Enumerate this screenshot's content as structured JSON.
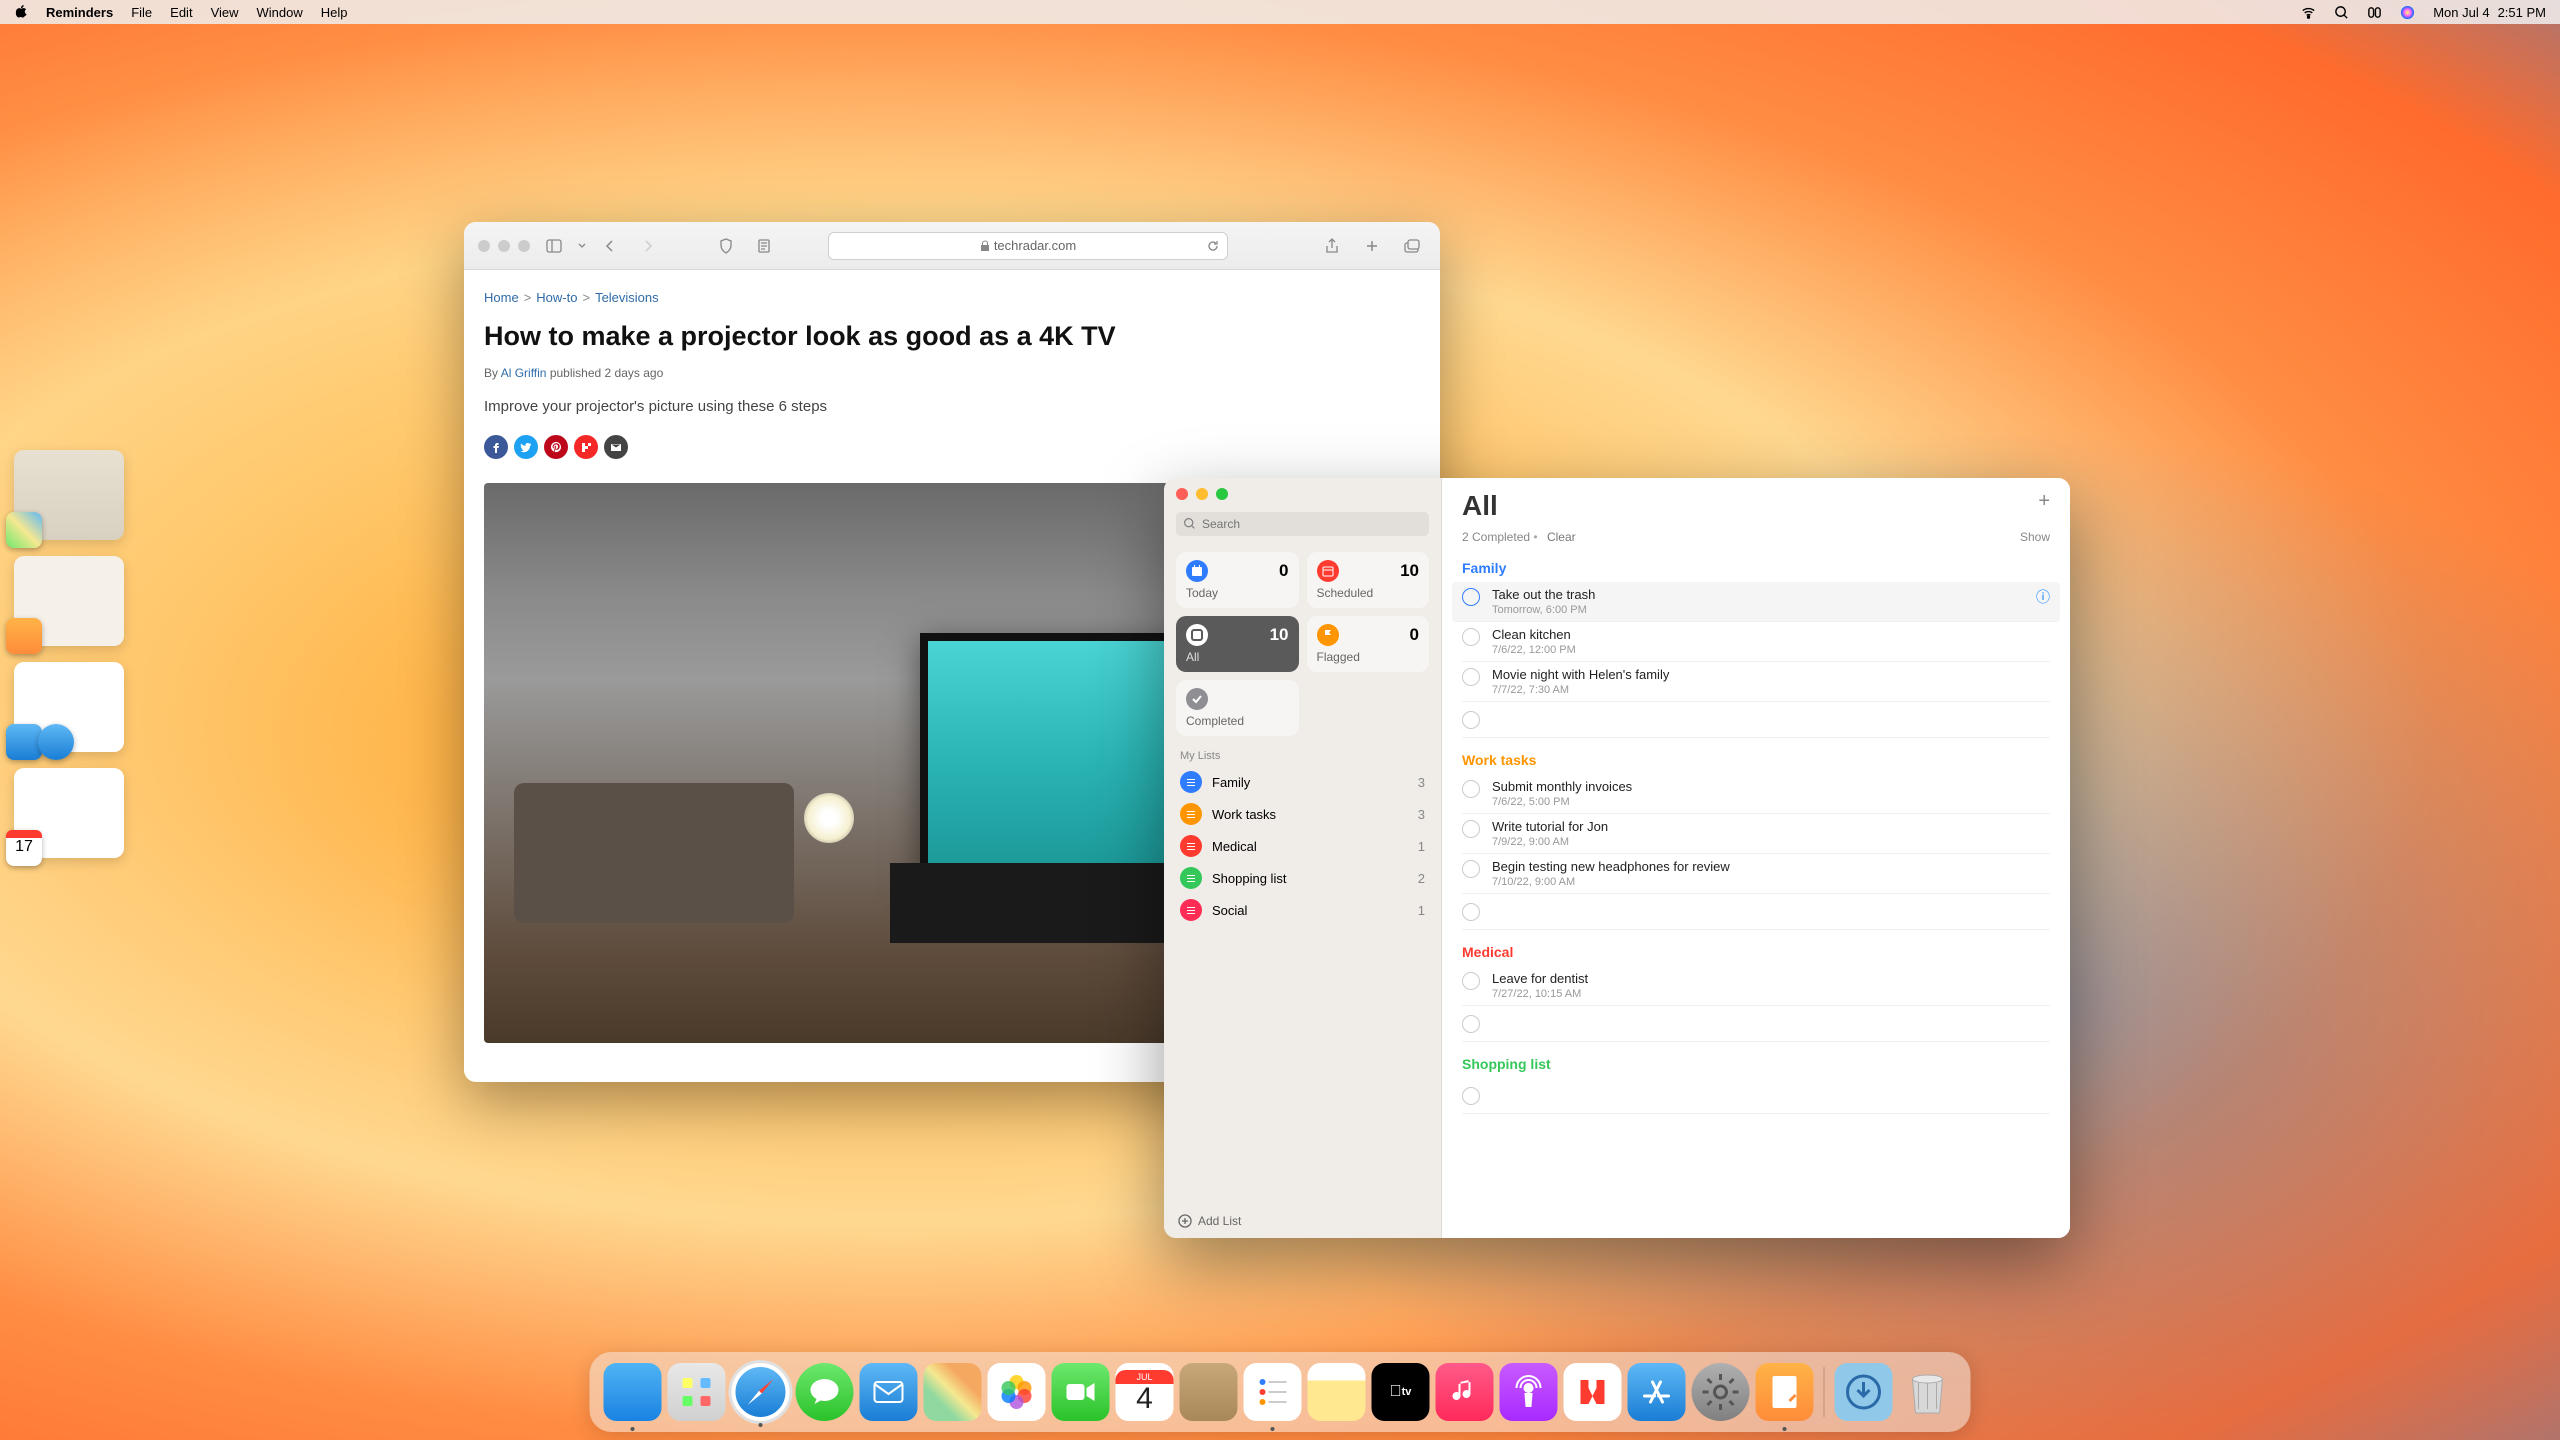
{
  "menubar": {
    "app_name": "Reminders",
    "menus": [
      "File",
      "Edit",
      "View",
      "Window",
      "Help"
    ],
    "date": "Mon Jul 4",
    "time": "2:51 PM"
  },
  "safari": {
    "url_host": "techradar.com",
    "breadcrumb": [
      "Home",
      "How-to",
      "Televisions"
    ],
    "title": "How to make a projector look as good as a 4K TV",
    "byline_prefix": "By",
    "author": "Al Griffin",
    "published": "published 2 days ago",
    "intro": "Improve your projector's picture using these 6 steps"
  },
  "reminders": {
    "search_placeholder": "Search",
    "smart_lists": {
      "today": {
        "label": "Today",
        "count": "0"
      },
      "scheduled": {
        "label": "Scheduled",
        "count": "10"
      },
      "all": {
        "label": "All",
        "count": "10"
      },
      "flagged": {
        "label": "Flagged",
        "count": "0"
      },
      "completed": {
        "label": "Completed"
      }
    },
    "my_lists_header": "My Lists",
    "lists": [
      {
        "name": "Family",
        "count": "3",
        "color": "#2f7cff"
      },
      {
        "name": "Work tasks",
        "count": "3",
        "color": "#ff9500"
      },
      {
        "name": "Medical",
        "count": "1",
        "color": "#ff3b30"
      },
      {
        "name": "Shopping list",
        "count": "2",
        "color": "#34c759"
      },
      {
        "name": "Social",
        "count": "1",
        "color": "#ff2d55"
      }
    ],
    "add_list": "Add List",
    "main_title": "All",
    "completed_text": "2 Completed",
    "clear_text": "Clear",
    "show_text": "Show",
    "sections": [
      {
        "title": "Family",
        "color": "#2f7cff",
        "items": [
          {
            "title": "Take out the trash",
            "date": "Tomorrow, 6:00 PM",
            "selected": true
          },
          {
            "title": "Clean kitchen",
            "date": "7/6/22, 12:00 PM"
          },
          {
            "title": "Movie night with Helen's family",
            "date": "7/7/22, 7:30 AM"
          }
        ]
      },
      {
        "title": "Work tasks",
        "color": "#ff9500",
        "items": [
          {
            "title": "Submit monthly invoices",
            "date": "7/6/22, 5:00 PM"
          },
          {
            "title": "Write tutorial for Jon",
            "date": "7/9/22, 9:00 AM"
          },
          {
            "title": "Begin testing new headphones for review",
            "date": "7/10/22, 9:00 AM"
          }
        ]
      },
      {
        "title": "Medical",
        "color": "#ff3b30",
        "items": [
          {
            "title": "Leave for dentist",
            "date": "7/27/22, 10:15 AM"
          }
        ]
      },
      {
        "title": "Shopping list",
        "color": "#34c759",
        "items": []
      }
    ]
  },
  "dock": {
    "calendar_month": "JUL",
    "calendar_day": "4",
    "tv_label": "tv"
  }
}
